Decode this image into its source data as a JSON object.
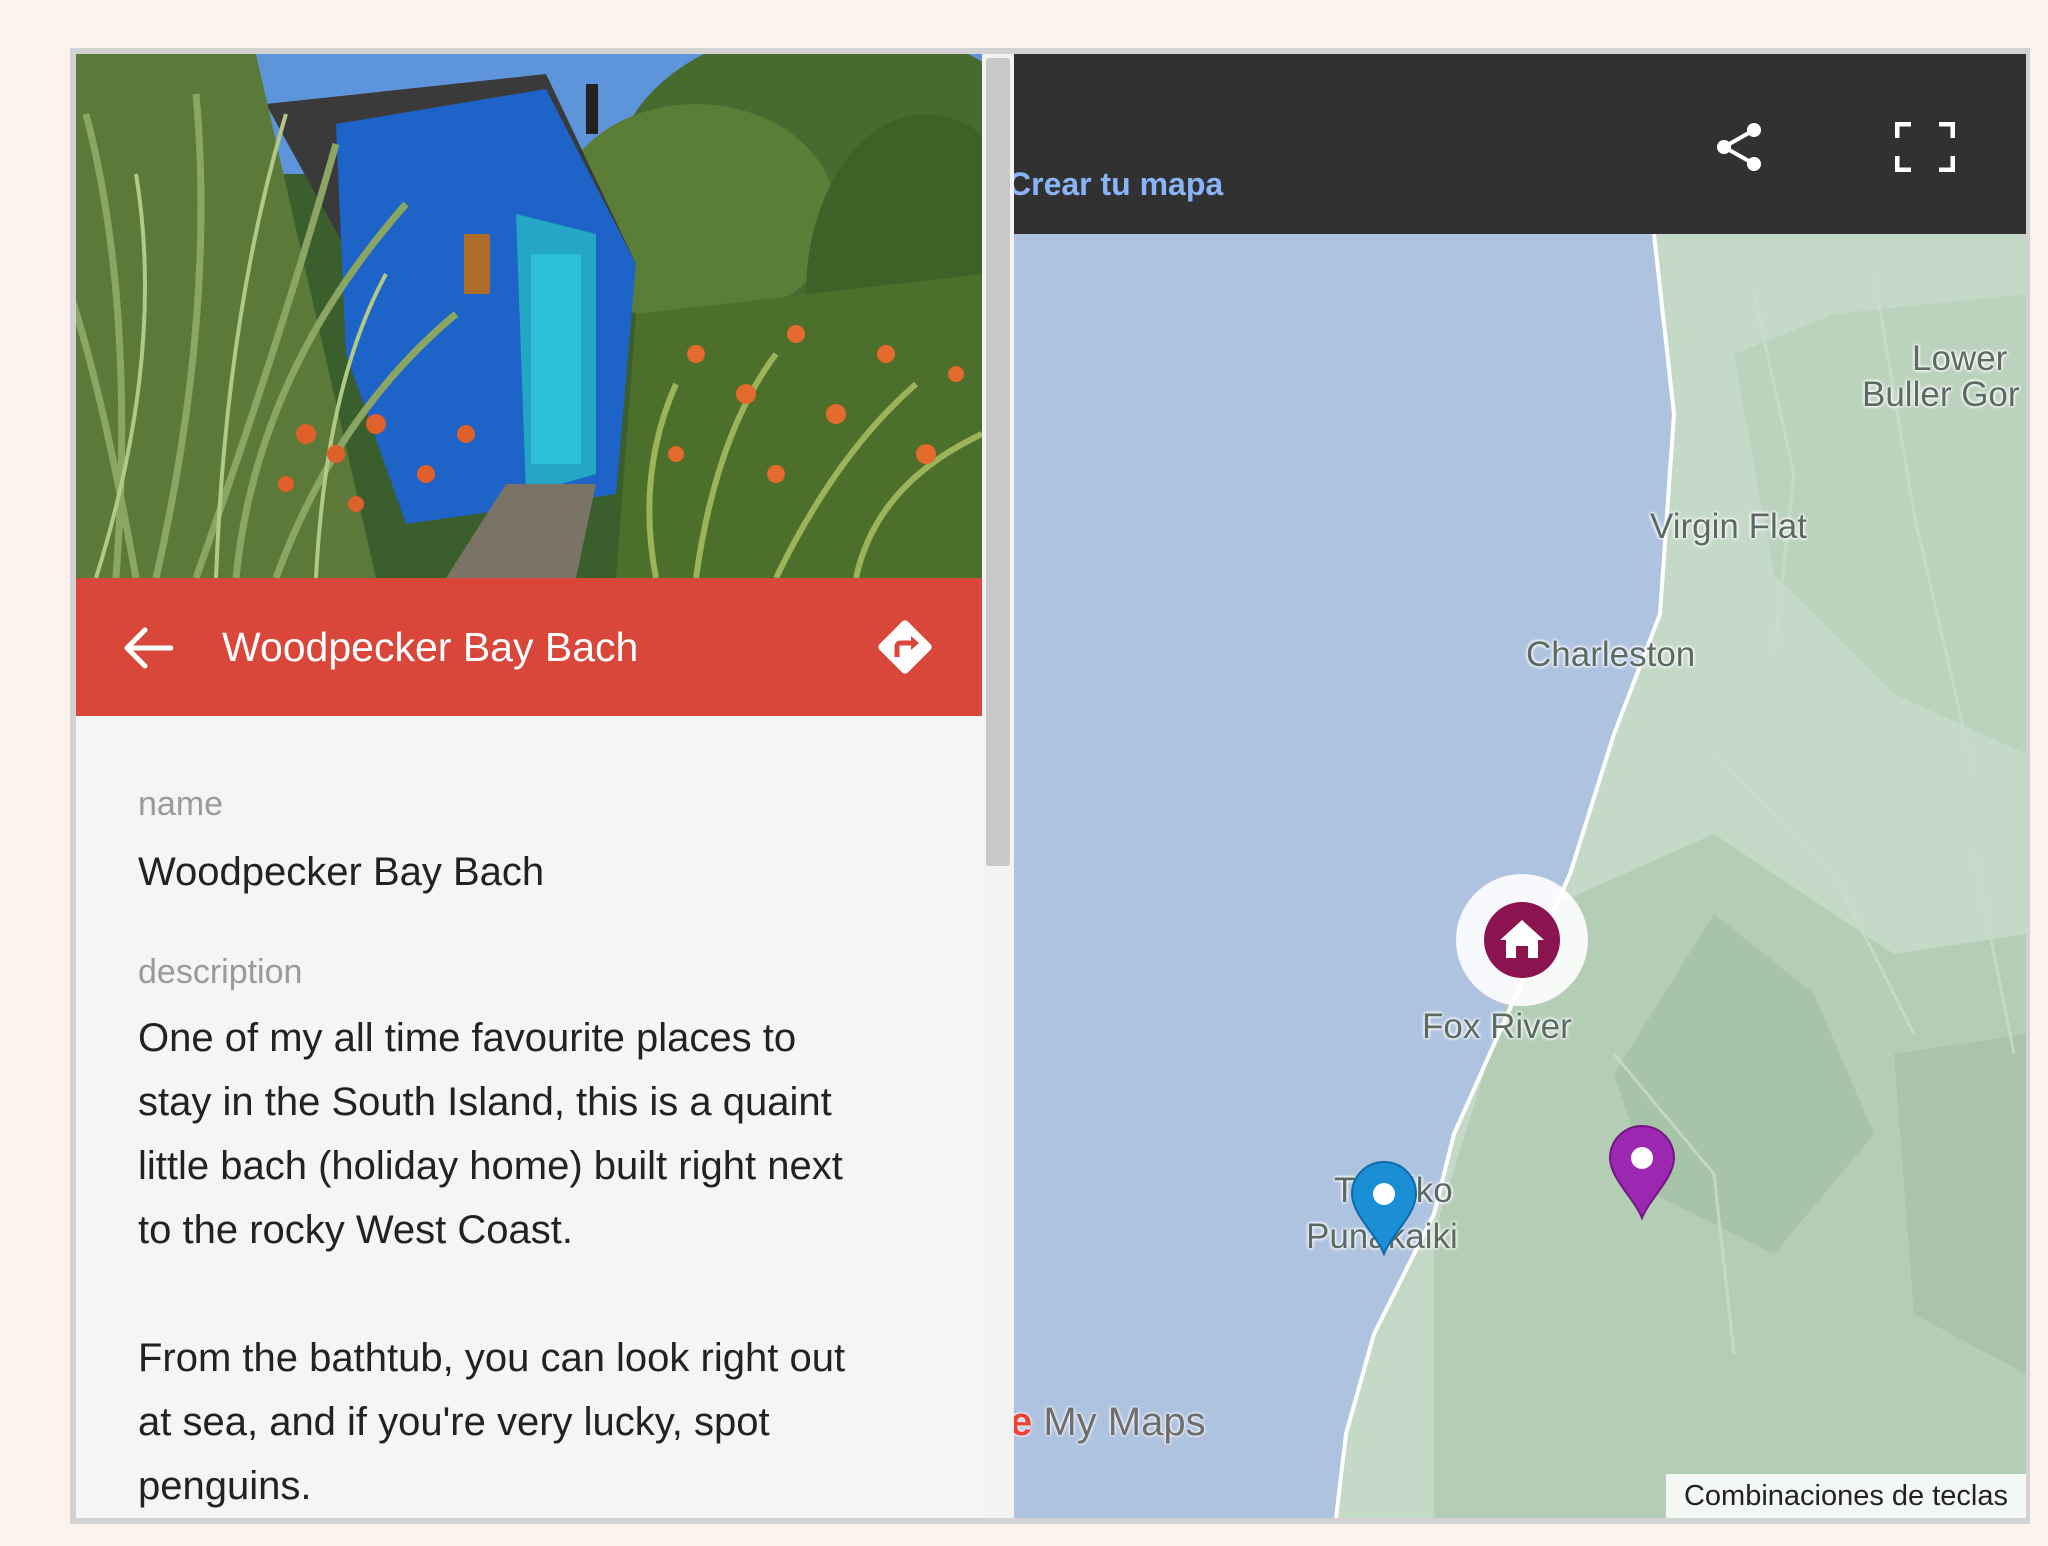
{
  "left_panel": {
    "header": {
      "title": "Woodpecker Bay Bach",
      "back_icon": "arrow-left-icon",
      "directions_icon": "directions-icon",
      "color": "#d9473a"
    },
    "fields": {
      "name_label": "name",
      "name_value": "Woodpecker Bay Bach",
      "description_label": "description",
      "description_lines": [
        "One of my all time favourite places to",
        "stay in the South Island, this is a quaint",
        "little bach (holiday home) built right next",
        "to the rocky West Coast.",
        "From the bathtub, you can look right out",
        "at sea, and if you're very lucky, spot",
        "penguins."
      ]
    }
  },
  "map": {
    "topbar": {
      "create_link": "Crear tu mapa",
      "share_icon": "share-icon",
      "fullscreen_icon": "fullscreen-icon"
    },
    "places": {
      "lower_buller_1": "Lower",
      "lower_buller_2": "Buller Gor",
      "virgin_flat": "Virgin Flat",
      "charleston": "Charleston",
      "fox_river": "Fox River",
      "tiromoana": "T",
      "tiromoana_end": "iko",
      "punakaiki": "Punakaiki"
    },
    "markers": [
      {
        "type": "home",
        "color": "#8a1350",
        "icon": "home-icon"
      },
      {
        "type": "pin",
        "color": "#1a8fd6",
        "icon": "map-pin-icon"
      },
      {
        "type": "pin",
        "color": "#9c27b0",
        "icon": "map-pin-icon"
      }
    ],
    "logo_g": "e",
    "logo_text": " My Maps",
    "shortcuts": "Combinaciones de teclas",
    "colors": {
      "sea": "#aec3e0",
      "land": "#c3d8c6"
    }
  }
}
